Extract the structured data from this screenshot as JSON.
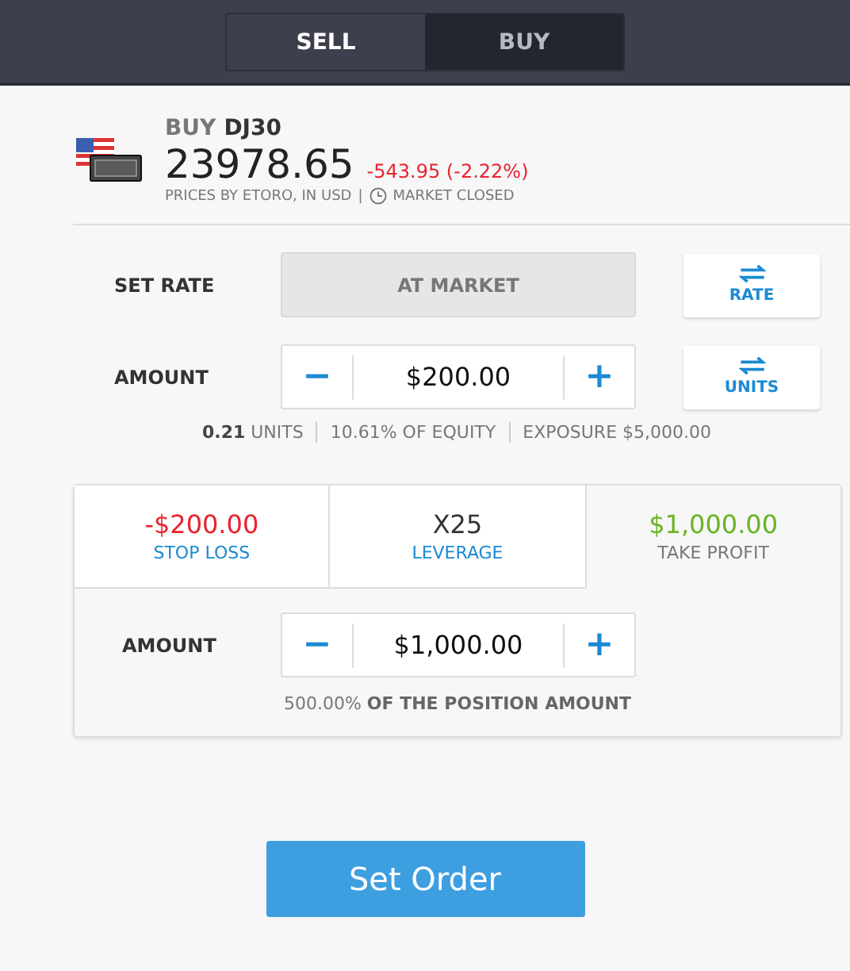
{
  "toggle": [
    {
      "label": "SELL",
      "selected": false
    },
    {
      "label": "BUY",
      "selected": true
    }
  ],
  "instrument": {
    "action": "BUY",
    "symbol": "DJ30",
    "price": "23978.65",
    "change": "-543.95 (-2.22%)",
    "source": "PRICES BY ETORO, IN USD",
    "separator": "|",
    "market_status": "MARKET CLOSED"
  },
  "set_rate": {
    "label": "SET RATE",
    "value": "AT MARKET",
    "switch_label": "RATE"
  },
  "amount": {
    "label": "AMOUNT",
    "minus": "−",
    "value": "$200.00",
    "plus": "+",
    "switch_label": "UNITS"
  },
  "stats": [
    "**0.21** UNITS",
    "10.61% OF EQUITY",
    "EXPOSURE $5,000.00"
  ],
  "risk_tabs": [
    {
      "value": "-$200.00",
      "label": "STOP LOSS",
      "kind": "loss",
      "selected": false
    },
    {
      "value": "X25",
      "label": "LEVERAGE",
      "kind": "leverage",
      "selected": false
    },
    {
      "value": "$1,000.00",
      "label": "TAKE PROFIT",
      "kind": "profit",
      "selected": true
    }
  ],
  "profit_amount": {
    "label": "AMOUNT",
    "minus": "−",
    "value": "$1,000.00",
    "plus": "+",
    "note": "500.00% **OF THE POSITION AMOUNT**"
  },
  "submit": "Set Order"
}
